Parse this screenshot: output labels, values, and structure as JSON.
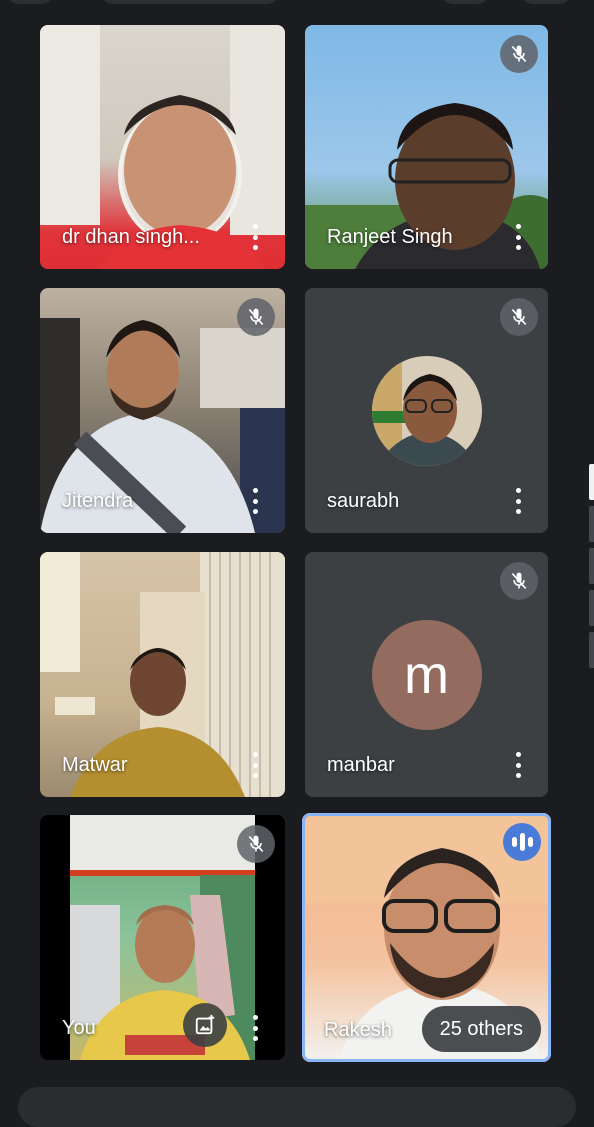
{
  "participants": [
    {
      "name": "dr dhan singh...",
      "muted": false
    },
    {
      "name": "Ranjeet Singh",
      "muted": true
    },
    {
      "name": "Jitendra",
      "muted": true
    },
    {
      "name": "saurabh",
      "muted": true
    },
    {
      "name": "Matwar",
      "muted": false
    },
    {
      "name": "manbar",
      "muted": true,
      "avatar_letter": "m",
      "avatar_color": "#936c5f"
    },
    {
      "name": "You",
      "muted": true
    },
    {
      "name": "Rakesh",
      "muted": false,
      "speaking": true
    }
  ],
  "others_label": "25 others",
  "icons": {
    "mute": "mic-off-icon",
    "more": "more-vert-icon",
    "speaking": "audio-level-icon",
    "pin": "add-photo-icon"
  },
  "colors": {
    "background": "#1b1c1f",
    "tile": "#3c4043",
    "speaking_accent": "#8ab4f8",
    "avatar_m": "#936c5f"
  }
}
